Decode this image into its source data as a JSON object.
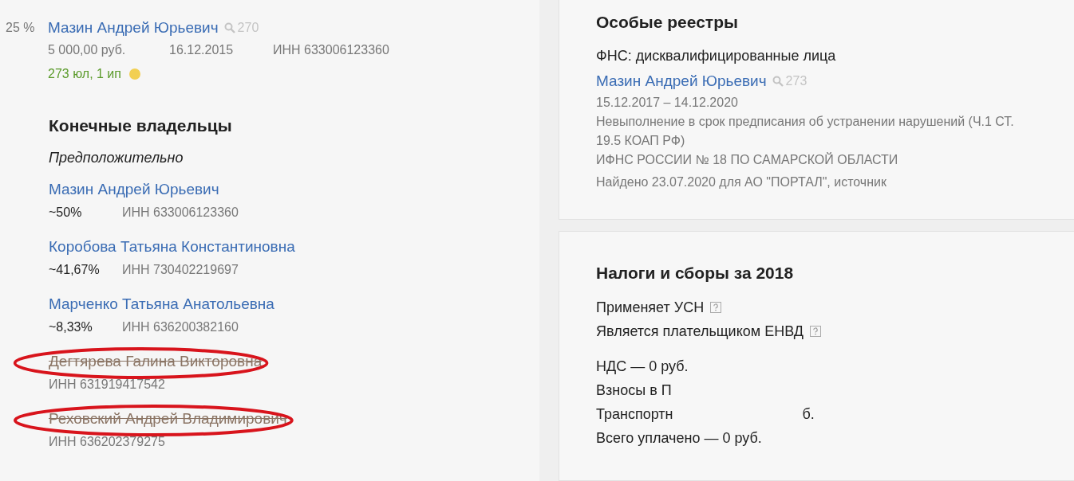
{
  "founder": {
    "share": "25 %",
    "name": "Мазин Андрей Юрьевич",
    "search_count": "270",
    "amount": "5 000,00 руб.",
    "date": "16.12.2015",
    "inn": "ИНН 633006123360",
    "links": "273 юл, 1 ип",
    "color": "#f2cf52"
  },
  "owners": {
    "title": "Конечные владельцы",
    "subtitle": "Предположительно",
    "items": [
      {
        "name": "Мазин Андрей Юрьевич",
        "share": "~50%",
        "inn": "ИНН 633006123360",
        "former": false,
        "circled": false
      },
      {
        "name": "Коробова Татьяна Константиновна",
        "share": "~41,67%",
        "inn": "ИНН 730402219697",
        "former": false,
        "circled": false
      },
      {
        "name": "Марченко Татьяна Анатольевна",
        "share": "~8,33%",
        "inn": "ИНН 636200382160",
        "former": false,
        "circled": false
      },
      {
        "name": "Дегтярева Галина Викторовна",
        "inn": "ИНН 631919417542",
        "former": true,
        "circled": true
      },
      {
        "name": "Реховский Андрей Владимирович",
        "inn": "ИНН 636202379275",
        "former": true,
        "circled": true
      }
    ]
  },
  "registers": {
    "title": "Особые реестры",
    "source": "ФНС: дисквалифицированные лица",
    "name": "Мазин Андрей Юрьевич",
    "search_count": "273",
    "period": "15.12.2017 – 14.12.2020",
    "reason": "Невыполнение в срок предписания об устранении нарушений (Ч.1 СТ. 19.5 КОАП РФ)",
    "authority": "ИФНС РОССИИ № 18 ПО САМАРСКОЙ ОБЛАСТИ",
    "found": "Найдено 23.07.2020 для АО \"ПОРТАЛ\", источник"
  },
  "taxes": {
    "title": "Налоги и сборы за 2018",
    "regimes": [
      {
        "label": "Применяет УСН"
      },
      {
        "label": "Является плательщиком ЕНВД"
      }
    ],
    "lines": [
      {
        "parts": [
          "НДС — 0 руб."
        ]
      },
      {
        "parts": [
          "Взносы в П"
        ]
      },
      {
        "parts": [
          "Транспортн",
          "б."
        ]
      },
      {
        "parts": [
          "Всего уплачено — 0 руб."
        ]
      }
    ]
  }
}
